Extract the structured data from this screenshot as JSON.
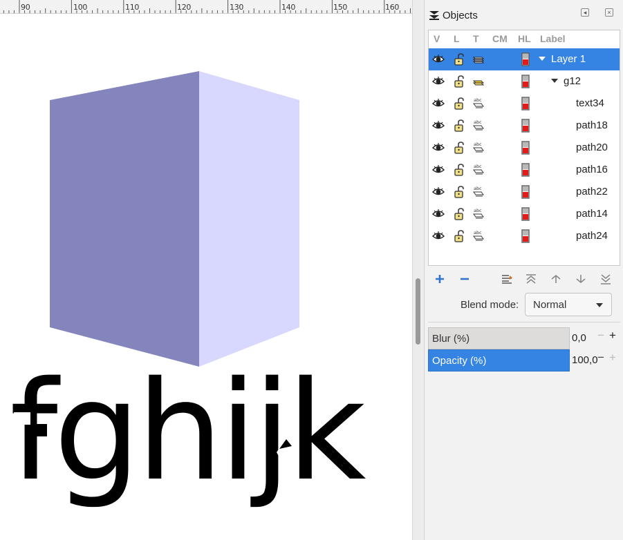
{
  "ruler": {
    "labels": [
      "90",
      "100",
      "110",
      "120",
      "130",
      "140",
      "150",
      "160"
    ]
  },
  "canvas": {
    "text": "fghijk",
    "box_left_color": "#8585bd",
    "box_right_color": "#d8d8ff"
  },
  "dock": {
    "title": "Objects",
    "columns": [
      "V",
      "L",
      "T",
      "CM",
      "HL",
      "Label"
    ],
    "rows": [
      {
        "label": "Layer 1",
        "type": "layer",
        "selected": true,
        "expanded": true
      },
      {
        "label": "g12",
        "type": "group",
        "selected": false,
        "expanded": true
      },
      {
        "label": "text34",
        "type": "text",
        "selected": false
      },
      {
        "label": "path18",
        "type": "path",
        "selected": false
      },
      {
        "label": "path20",
        "type": "path",
        "selected": false
      },
      {
        "label": "path16",
        "type": "path",
        "selected": false
      },
      {
        "label": "path22",
        "type": "path",
        "selected": false
      },
      {
        "label": "path14",
        "type": "path",
        "selected": false
      },
      {
        "label": "path24",
        "type": "path",
        "selected": false
      }
    ],
    "blend": {
      "label": "Blend mode:",
      "value": "Normal"
    },
    "blur": {
      "label": "Blur (%)",
      "value": "0,0"
    },
    "opacity": {
      "label": "Opacity (%)",
      "value": "100,0"
    }
  },
  "colors": {
    "accent": "#3584e4",
    "highlight_red": "#e21a1a"
  }
}
